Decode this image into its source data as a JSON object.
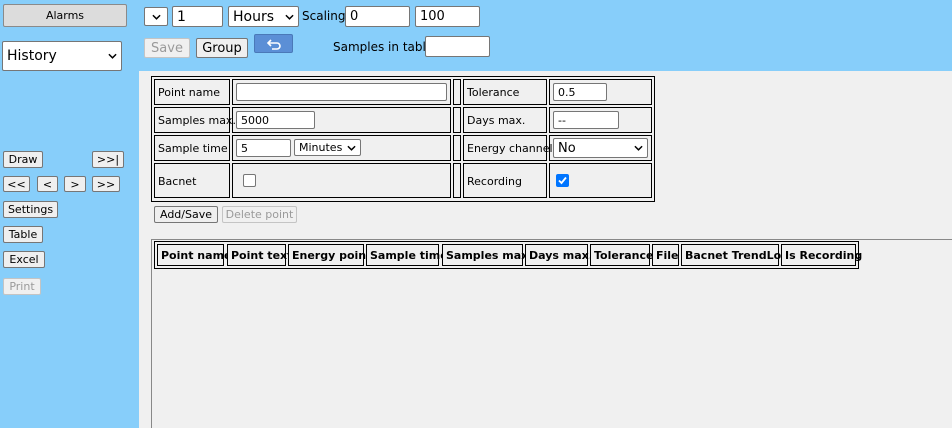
{
  "sidebar": {
    "alarms_label": "Alarms",
    "view_select": "History",
    "draw_label": "Draw",
    "last_label": ">>|",
    "first_label": "<<",
    "prev_label": "<",
    "next_label": ">",
    "forward_label": ">>",
    "settings_label": "Settings",
    "table_label": "Table",
    "excel_label": "Excel",
    "print_label": "Print"
  },
  "toolbar": {
    "period_value": "1",
    "unit_select": "Hours",
    "scaling_label": "Scaling",
    "scaling_min": "0",
    "scaling_max": "100",
    "save_label": "Save",
    "group_label": "Group",
    "samples_in_table_label": "Samples in table",
    "samples_in_table_value": ""
  },
  "form": {
    "point_name_label": "Point name",
    "point_name_value": "",
    "samples_max_label": "Samples max.",
    "samples_max_value": "5000",
    "sample_time_label": "Sample time",
    "sample_time_value": "5",
    "sample_time_unit": "Minutes",
    "bacnet_label": "Bacnet",
    "tolerance_label": "Tolerance",
    "tolerance_value": "0.5",
    "days_max_label": "Days max.",
    "days_max_value": "--",
    "energy_channel_label": "Energy channel",
    "energy_channel_value": "No",
    "recording_label": "Recording",
    "add_save_label": "Add/Save",
    "delete_point_label": "Delete point"
  },
  "table": {
    "headers": [
      "Point name",
      "Point text",
      "Energy point",
      "Sample time",
      "Samples max.",
      "Days max.",
      "Tolerance",
      "File",
      "Bacnet TrendLog",
      "Is Recording"
    ]
  },
  "colors": {
    "background": "#87cefa",
    "panel": "#f0f0f0",
    "checkbox_checked": "#0075ff",
    "undo_button": "#5b8fd6"
  }
}
